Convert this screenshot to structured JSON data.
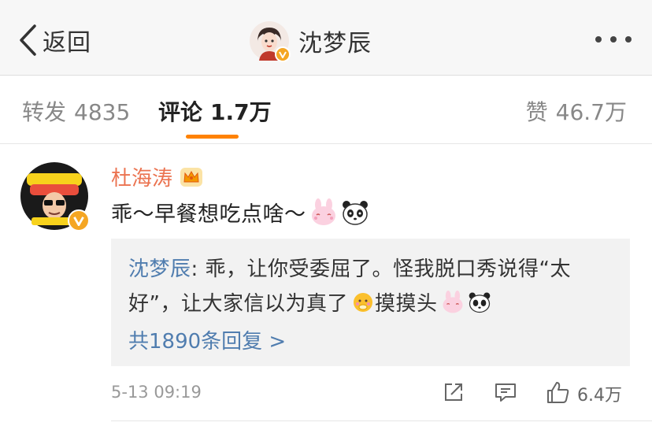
{
  "nav": {
    "back_label": "返回",
    "title": "沈梦辰",
    "more_icon": "more-dots-icon",
    "verified_color": "#f5a623"
  },
  "tabs": {
    "forward_label": "转发",
    "forward_count": "4835",
    "comment_label": "评论",
    "comment_count": "1.7万",
    "like_label": "赞",
    "like_count": "46.7万",
    "active_color": "#ff8200"
  },
  "comment": {
    "author": "杜海涛",
    "author_color": "#eb7350",
    "text": "乖～早餐想吃点啥～",
    "emojis": [
      "bunny-emoji",
      "panda-emoji"
    ],
    "reply": {
      "name": "沈梦辰",
      "line1": ": 乖，让你受委屈了。怪我脱口秀说得“太",
      "line2_a": "好”，让大家信以为真了",
      "line2_b": " 摸摸头",
      "link_color": "#507daf",
      "more_label": "共1890条回复 >"
    },
    "time": "5-13 09:19",
    "like_count": "6.4万"
  }
}
